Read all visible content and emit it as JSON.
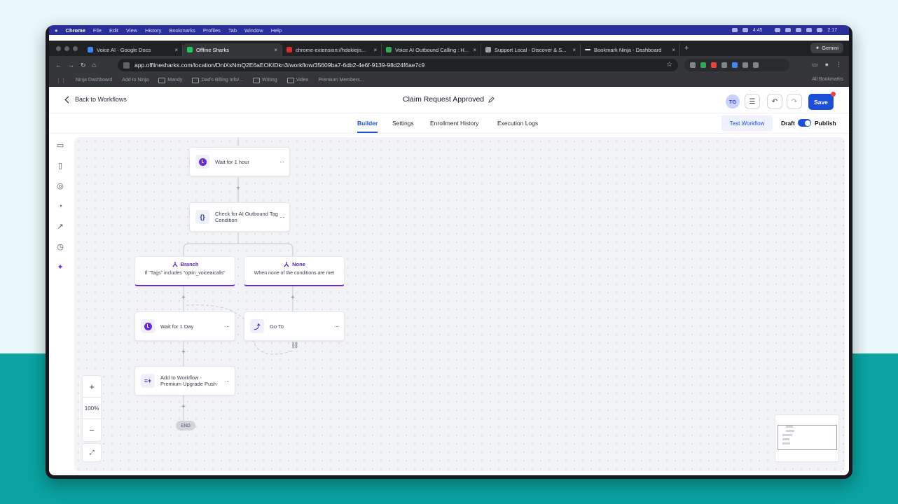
{
  "menubar": {
    "app": "Chrome",
    "items": [
      "File",
      "Edit",
      "View",
      "History",
      "Bookmarks",
      "Profiles",
      "Tab",
      "Window",
      "Help"
    ],
    "timer": "4:45",
    "clock": "2:17"
  },
  "tabs": [
    {
      "title": "Voice AI - Google Docs",
      "color": "#4285f4"
    },
    {
      "title": "Offline Sharks",
      "color": "#22c55e"
    },
    {
      "title": "chrome-extension://hdokiejn...",
      "color": "#d93025"
    },
    {
      "title": "Voice AI Outbound Calling : H...",
      "color": "#34a853"
    },
    {
      "title": "Support Local - Discover & S...",
      "color": "#9aa0a6"
    },
    {
      "title": "Bookmark Ninja - Dashboard",
      "color": "#e8eaed"
    }
  ],
  "gemini_label": "Gemini",
  "address": {
    "url": "app.offlinesharks.com/location/DniXsNmQ2E6aEOKIDkn3/workflow/35609ba7-6db2-4e6f-9139-98d24f6ae7c9"
  },
  "bookmarks": {
    "items": [
      "Ninja Dashboard",
      "Add to Ninja",
      "Mandy",
      "Dad's Billing Info/...",
      "Writing",
      "Video",
      "Premium Members..."
    ],
    "all": "All Bookmarks"
  },
  "header": {
    "back_label": "Back to Workflows",
    "title": "Claim Request Approved",
    "avatar": "TG",
    "save_label": "Save"
  },
  "subnav": {
    "tabs": [
      "Builder",
      "Settings",
      "Enrollment History",
      "Execution Logs"
    ],
    "active": "Builder",
    "test_label": "Test Workflow",
    "draft_label": "Draft",
    "publish_label": "Publish",
    "published": true
  },
  "nodes": {
    "wait_hour": "Wait for 1 hour",
    "condition": [
      "Check for AI Outbound Tag",
      "Condition"
    ],
    "branch": {
      "title": "Branch",
      "desc": "If \"Tags\" includes \"optin_voiceaicalls\""
    },
    "none": {
      "title": "None",
      "desc": "When none of the conditions are met"
    },
    "wait_day": "Wait for 1 Day",
    "goto": "Go To",
    "add_workflow": [
      "Add to Workflow -",
      "Premium Upgrade Push"
    ],
    "end": "END"
  },
  "zoom": {
    "in": "+",
    "level": "100%",
    "out": "−"
  },
  "colors": {
    "accent": "#1d4ed8",
    "purple": "#6d28d9",
    "teal_bg": "#0aa3a0"
  }
}
